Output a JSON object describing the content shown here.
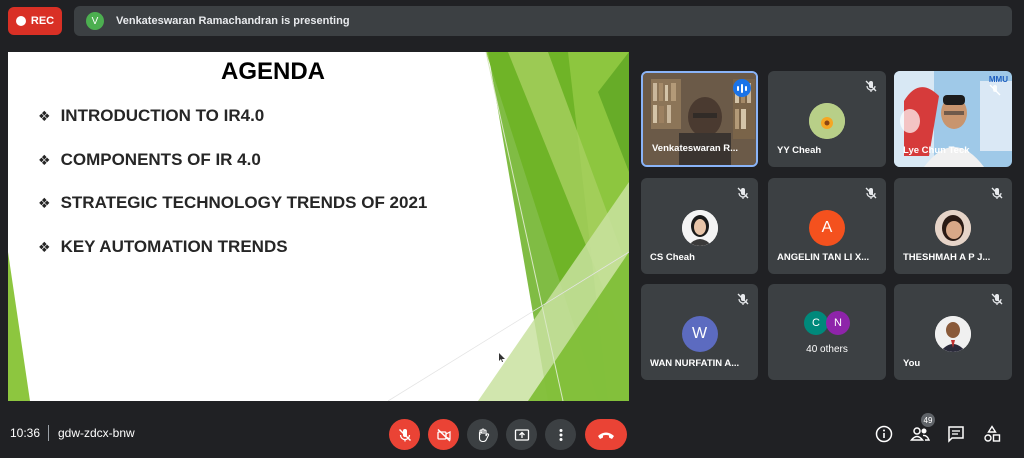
{
  "top": {
    "rec_label": "REC",
    "presenter_initial": "V",
    "presenting_text": "Venkateswaran Ramachandran is presenting"
  },
  "slide": {
    "title": "AGENDA",
    "items": [
      "INTRODUCTION TO IR4.0",
      "COMPONENTS OF IR 4.0",
      "STRATEGIC TECHNOLOGY TRENDS OF 2021",
      "KEY AUTOMATION TRENDS"
    ],
    "bullet": "❖"
  },
  "participants": [
    {
      "name": "Venkateswaran R...",
      "kind": "video-speaking"
    },
    {
      "name": "YY Cheah",
      "kind": "photo"
    },
    {
      "name": "Lye Chun Teck",
      "kind": "video",
      "logo": "MMU"
    },
    {
      "name": "CS Cheah",
      "kind": "photo"
    },
    {
      "name": "ANGELIN TAN LI X...",
      "kind": "letter",
      "initial": "A"
    },
    {
      "name": "THESHMAH A P J...",
      "kind": "photo"
    },
    {
      "name": "WAN NURFATIN A...",
      "kind": "letter",
      "initial": "W"
    },
    {
      "name": "40 others",
      "kind": "group",
      "initials": [
        "C",
        "N"
      ]
    },
    {
      "name": "You",
      "kind": "photo"
    }
  ],
  "bottom": {
    "time": "10:36",
    "meeting_code": "gdw-zdcx-bnw",
    "people_count": "49"
  },
  "colors": {
    "background": "#202124",
    "tile": "#3c4043",
    "danger": "#ea4335",
    "accent_blue": "#1a73e8",
    "avatar_orange": "#f4511e",
    "avatar_indigo": "#5c6bc0",
    "slide_green": "#8dc63f"
  }
}
